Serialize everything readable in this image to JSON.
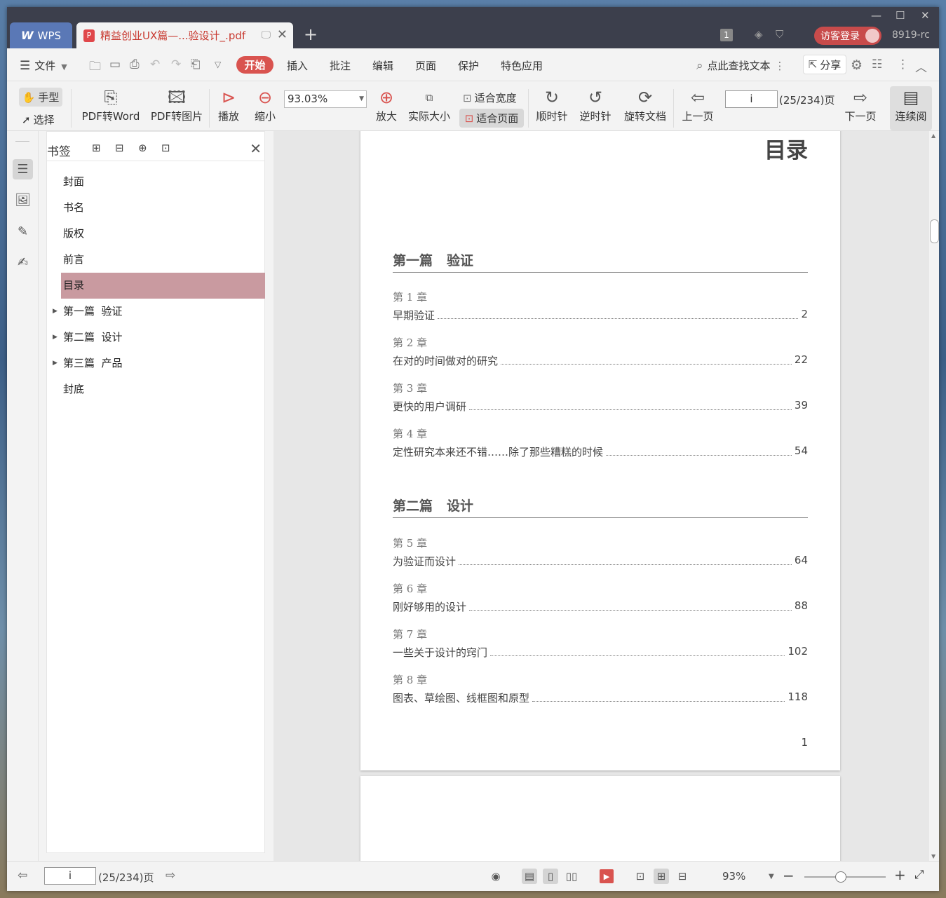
{
  "titlebar": {
    "app_tab": "WPS",
    "doc_tab": "精益创业UX篇—...验设计_.pdf",
    "badge": "1",
    "login": "访客登录",
    "user": "8919-rc"
  },
  "menu": {
    "file": "文件",
    "start": "开始",
    "items": [
      "插入",
      "批注",
      "编辑",
      "页面",
      "保护",
      "特色应用"
    ],
    "search": "点此查找文本",
    "share": "分享"
  },
  "toolbar": {
    "hand": "手型",
    "select": "选择",
    "pdf_to_word": "PDF转Word",
    "pdf_to_image": "PDF转图片",
    "play": "播放",
    "zoom_out": "缩小",
    "zoom_value": "93.03%",
    "zoom_in": "放大",
    "actual_size": "实际大小",
    "fit_width": "适合宽度",
    "fit_page": "适合页面",
    "clockwise": "顺时针",
    "counterclockwise": "逆时针",
    "rotate_doc": "旋转文档",
    "prev_page": "上一页",
    "page_value": "i",
    "page_count": "(25/234)页",
    "next_page": "下一页",
    "continuous": "连续阅"
  },
  "bookmarks": {
    "title": "书签",
    "items": [
      {
        "label": "封面"
      },
      {
        "label": "书名"
      },
      {
        "label": "版权"
      },
      {
        "label": "前言"
      },
      {
        "label": "目录"
      },
      {
        "label": "第一篇  验证"
      },
      {
        "label": "第二篇  设计"
      },
      {
        "label": "第三篇  产品"
      },
      {
        "label": "封底"
      }
    ]
  },
  "page": {
    "title": "目录",
    "parts": [
      {
        "label": "第一篇",
        "name": "验证"
      },
      {
        "label": "第二篇",
        "name": "设计"
      }
    ],
    "chapters": [
      {
        "no": "第 1 章",
        "title": "早期验证",
        "page": "2"
      },
      {
        "no": "第 2 章",
        "title": "在对的时间做对的研究",
        "page": "22"
      },
      {
        "no": "第 3 章",
        "title": "更快的用户调研",
        "page": "39"
      },
      {
        "no": "第 4 章",
        "title": "定性研究本来还不错……除了那些糟糕的时候",
        "page": "54"
      },
      {
        "no": "第 5 章",
        "title": "为验证而设计",
        "page": "64"
      },
      {
        "no": "第 6 章",
        "title": "刚好够用的设计",
        "page": "88"
      },
      {
        "no": "第 7 章",
        "title": "一些关于设计的窍门",
        "page": "102"
      },
      {
        "no": "第 8 章",
        "title": "图表、草绘图、线框图和原型",
        "page": "118"
      }
    ],
    "page_number": "1"
  },
  "status": {
    "page_value": "i",
    "page_count": "(25/234)页",
    "zoom": "93%"
  },
  "colors": {
    "titlebar_bg": "#3c3f4c",
    "accent_red": "#d9534f",
    "bookmark_active": "#c99aa0"
  }
}
